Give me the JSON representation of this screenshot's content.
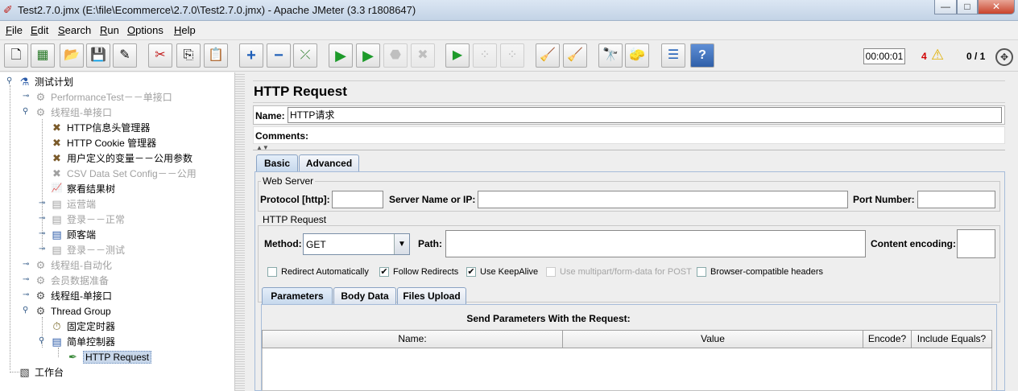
{
  "window": {
    "title": "Test2.7.0.jmx (E:\\file\\Ecommerce\\2.7.0\\Test2.7.0.jmx) - Apache JMeter (3.3 r1808647)",
    "app_icon": "jmeter-feather-icon",
    "controls": {
      "minimize": "—",
      "maximize": "□",
      "close": "✕"
    }
  },
  "menu": [
    {
      "label": "File",
      "mnemonic": "F"
    },
    {
      "label": "Edit",
      "mnemonic": "E"
    },
    {
      "label": "Search",
      "mnemonic": "S"
    },
    {
      "label": "Run",
      "mnemonic": "R"
    },
    {
      "label": "Options",
      "mnemonic": "O"
    },
    {
      "label": "Help",
      "mnemonic": "H"
    }
  ],
  "toolbar": {
    "buttons": [
      {
        "icon": "new-icon",
        "glyph": "🗋"
      },
      {
        "icon": "templates-icon",
        "glyph": "▦"
      },
      {
        "icon": "open-icon",
        "glyph": "📂"
      },
      {
        "icon": "save-icon",
        "glyph": "💾"
      },
      {
        "icon": "save-as-icon",
        "glyph": "✎"
      },
      {
        "icon": "cut-icon",
        "glyph": "✂"
      },
      {
        "icon": "copy-icon",
        "glyph": "⎘"
      },
      {
        "icon": "paste-icon",
        "glyph": "📋"
      },
      {
        "icon": "expand-icon",
        "glyph": "+"
      },
      {
        "icon": "collapse-icon",
        "glyph": "−"
      },
      {
        "icon": "toggle-icon",
        "glyph": "⤫"
      },
      {
        "icon": "start-icon",
        "glyph": "▶"
      },
      {
        "icon": "start-no-pauses-icon",
        "glyph": "▶"
      },
      {
        "icon": "stop-icon",
        "glyph": "⬣"
      },
      {
        "icon": "shutdown-icon",
        "glyph": "✖"
      },
      {
        "icon": "remote-start-icon",
        "glyph": "▶"
      },
      {
        "icon": "remote-stop-icon",
        "glyph": "⁘"
      },
      {
        "icon": "remote-shutdown-icon",
        "glyph": "⁘"
      },
      {
        "icon": "clear-icon",
        "glyph": "🧹"
      },
      {
        "icon": "clear-all-icon",
        "glyph": "🧹"
      },
      {
        "icon": "search-icon",
        "glyph": "🔭"
      },
      {
        "icon": "reset-search-icon",
        "glyph": "🧽"
      },
      {
        "icon": "function-helper-icon",
        "glyph": "☰"
      },
      {
        "icon": "help-icon",
        "glyph": "?"
      }
    ],
    "elapsed_time": "00:00:01",
    "error_count": "4",
    "active_threads": "0 / 1"
  },
  "tree": [
    {
      "label": "测试计划",
      "icon": "test-plan-icon",
      "glyph": "⚗",
      "disabled": false
    },
    {
      "label": "PerformanceTest－－单接口",
      "icon": "thread-group-icon",
      "glyph": "⚙",
      "disabled": true
    },
    {
      "label": "线程组-单接口",
      "icon": "thread-group-icon",
      "glyph": "⚙",
      "disabled": true
    },
    {
      "label": "HTTP信息头管理器",
      "icon": "config-element-icon",
      "glyph": "✖",
      "disabled": false
    },
    {
      "label": "HTTP Cookie 管理器",
      "icon": "config-element-icon",
      "glyph": "✖",
      "disabled": false
    },
    {
      "label": "用户定义的变量－－公用参数",
      "icon": "config-element-icon",
      "glyph": "✖",
      "disabled": false
    },
    {
      "label": "CSV Data Set Config－－公用",
      "icon": "config-element-icon",
      "glyph": "✖",
      "disabled": true
    },
    {
      "label": "察看结果树",
      "icon": "listener-icon",
      "glyph": "📈",
      "disabled": false
    },
    {
      "label": "运营端",
      "icon": "controller-icon",
      "glyph": "▤",
      "disabled": true
    },
    {
      "label": "登录－－正常",
      "icon": "controller-icon",
      "glyph": "▤",
      "disabled": true
    },
    {
      "label": "顾客端",
      "icon": "controller-icon",
      "glyph": "▤",
      "disabled": false
    },
    {
      "label": "登录－－测试",
      "icon": "controller-icon",
      "glyph": "▤",
      "disabled": true
    },
    {
      "label": "线程组-自动化",
      "icon": "thread-group-icon",
      "glyph": "⚙",
      "disabled": true
    },
    {
      "label": "会员数据准备",
      "icon": "thread-group-icon",
      "glyph": "⚙",
      "disabled": true
    },
    {
      "label": "线程组-单接口",
      "icon": "thread-group-icon",
      "glyph": "⚙",
      "disabled": false
    },
    {
      "label": "Thread Group",
      "icon": "thread-group-icon",
      "glyph": "⚙",
      "disabled": false
    },
    {
      "label": "固定定时器",
      "icon": "timer-icon",
      "glyph": "⏱",
      "disabled": false
    },
    {
      "label": "简单控制器",
      "icon": "controller-icon",
      "glyph": "▤",
      "disabled": false
    },
    {
      "label": "HTTP Request",
      "icon": "sampler-icon",
      "glyph": "✒",
      "disabled": false,
      "selected": true
    },
    {
      "label": "工作台",
      "icon": "workbench-icon",
      "glyph": "▧",
      "disabled": false
    }
  ],
  "panel": {
    "title": "HTTP Request",
    "name_label": "Name:",
    "name_value": "HTTP请求",
    "comments_label": "Comments:",
    "tabs": [
      {
        "label": "Basic",
        "active": true
      },
      {
        "label": "Advanced",
        "active": false
      }
    ],
    "web_server": {
      "title": "Web Server",
      "protocol_label": "Protocol [http]:",
      "protocol_value": "",
      "server_label": "Server Name or IP:",
      "server_value": "",
      "port_label": "Port Number:",
      "port_value": ""
    },
    "http_request": {
      "title": "HTTP Request",
      "method_label": "Method:",
      "method_value": "GET",
      "path_label": "Path:",
      "path_value": "",
      "encoding_label": "Content encoding:",
      "encoding_value": ""
    },
    "checkboxes": [
      {
        "label": "Redirect Automatically",
        "checked": false,
        "disabled": false
      },
      {
        "label": "Follow Redirects",
        "checked": true,
        "disabled": false
      },
      {
        "label": "Use KeepAlive",
        "checked": true,
        "disabled": false
      },
      {
        "label": "Use multipart/form-data for POST",
        "checked": false,
        "disabled": true
      },
      {
        "label": "Browser-compatible headers",
        "checked": false,
        "disabled": false
      }
    ],
    "sub_tabs": [
      {
        "label": "Parameters",
        "active": true
      },
      {
        "label": "Body Data",
        "active": false
      },
      {
        "label": "Files Upload",
        "active": false
      }
    ],
    "params_heading": "Send Parameters With the Request:",
    "columns": [
      "Name:",
      "Value",
      "Encode?",
      "Include Equals?"
    ]
  }
}
